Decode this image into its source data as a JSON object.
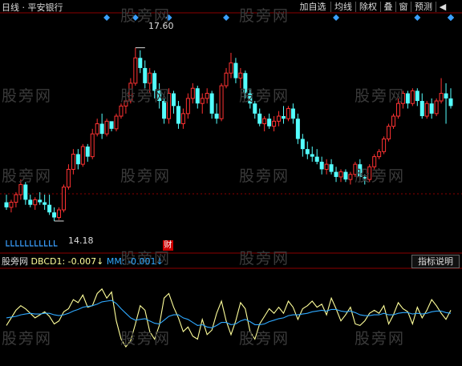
{
  "toolbar": {
    "title": "日线 · 平安银行",
    "buttons": [
      "加自选",
      "均线",
      "除权",
      "叠",
      "窗",
      "预测"
    ],
    "arrow": "◀"
  },
  "watermark": "股旁网",
  "price_panel": {
    "max_label": "17.60",
    "min_label": "14.18",
    "finance_badge": "财"
  },
  "indicator_panel": {
    "prefix": "股旁网",
    "dbcd_label": "DBCD1: -0.007",
    "mm_label": "MM: -0.001",
    "help_button": "指标说明"
  },
  "colors": {
    "up": "#ff3232",
    "down": "#54ffff",
    "dbcd": "#ffff9a",
    "mm": "#2fa9ff",
    "grid": "#8b0000",
    "marker": "#3aa0ff"
  },
  "chart_data": [
    {
      "type": "candlestick",
      "title": "日线 平安银行",
      "ylim": [
        13.8,
        18.1
      ],
      "annotations": [
        {
          "text": "17.60",
          "at": "high"
        },
        {
          "text": "14.18",
          "at": "low"
        }
      ],
      "candles": [
        [
          14.55,
          14.7,
          14.4,
          14.45
        ],
        [
          14.45,
          14.6,
          14.35,
          14.55
        ],
        [
          14.55,
          14.75,
          14.45,
          14.7
        ],
        [
          14.7,
          15.0,
          14.6,
          14.9
        ],
        [
          14.9,
          14.95,
          14.5,
          14.6
        ],
        [
          14.6,
          14.7,
          14.45,
          14.5
        ],
        [
          14.5,
          14.65,
          14.4,
          14.6
        ],
        [
          14.6,
          14.75,
          14.5,
          14.55
        ],
        [
          14.55,
          14.7,
          14.4,
          14.5
        ],
        [
          14.5,
          14.7,
          14.3,
          14.35
        ],
        [
          14.35,
          14.45,
          14.18,
          14.25
        ],
        [
          14.25,
          14.45,
          14.2,
          14.4
        ],
        [
          14.4,
          14.9,
          14.35,
          14.85
        ],
        [
          14.85,
          15.3,
          14.8,
          15.2
        ],
        [
          15.2,
          15.6,
          15.1,
          15.5
        ],
        [
          15.5,
          15.6,
          15.2,
          15.3
        ],
        [
          15.3,
          15.7,
          15.25,
          15.65
        ],
        [
          15.65,
          15.7,
          15.35,
          15.45
        ],
        [
          15.45,
          16.0,
          15.4,
          15.9
        ],
        [
          15.9,
          16.2,
          15.85,
          16.1
        ],
        [
          16.1,
          16.3,
          15.8,
          15.9
        ],
        [
          15.9,
          16.2,
          15.85,
          16.15
        ],
        [
          16.15,
          16.1,
          15.95,
          16.0
        ],
        [
          16.0,
          16.3,
          15.95,
          16.25
        ],
        [
          16.25,
          16.5,
          16.2,
          16.45
        ],
        [
          16.45,
          16.6,
          16.3,
          16.55
        ],
        [
          16.55,
          17.0,
          16.5,
          16.9
        ],
        [
          16.9,
          17.6,
          16.85,
          17.4
        ],
        [
          17.4,
          17.55,
          17.1,
          17.2
        ],
        [
          17.2,
          17.35,
          16.8,
          16.9
        ],
        [
          16.9,
          17.2,
          16.7,
          17.1
        ],
        [
          17.1,
          17.15,
          16.6,
          16.75
        ],
        [
          16.75,
          16.9,
          16.4,
          16.55
        ],
        [
          16.55,
          16.6,
          16.1,
          16.2
        ],
        [
          16.2,
          16.8,
          16.1,
          16.7
        ],
        [
          16.7,
          16.75,
          16.3,
          16.45
        ],
        [
          16.45,
          16.55,
          16.0,
          16.1
        ],
        [
          16.1,
          16.4,
          16.0,
          16.3
        ],
        [
          16.3,
          16.7,
          16.2,
          16.6
        ],
        [
          16.6,
          16.9,
          16.5,
          16.8
        ],
        [
          16.8,
          16.85,
          16.4,
          16.5
        ],
        [
          16.5,
          16.7,
          16.3,
          16.6
        ],
        [
          16.6,
          16.8,
          16.5,
          16.7
        ],
        [
          16.7,
          16.75,
          16.2,
          16.3
        ],
        [
          16.3,
          16.5,
          16.1,
          16.2
        ],
        [
          16.2,
          16.9,
          16.15,
          16.85
        ],
        [
          16.85,
          17.2,
          16.8,
          17.1
        ],
        [
          17.1,
          17.5,
          17.0,
          17.3
        ],
        [
          17.3,
          17.4,
          16.9,
          17.0
        ],
        [
          17.0,
          17.2,
          16.8,
          17.1
        ],
        [
          17.1,
          17.15,
          16.6,
          16.7
        ],
        [
          16.7,
          16.8,
          16.4,
          16.5
        ],
        [
          16.5,
          16.55,
          16.2,
          16.3
        ],
        [
          16.3,
          16.4,
          16.05,
          16.1
        ],
        [
          16.1,
          16.25,
          15.95,
          16.2
        ],
        [
          16.2,
          16.3,
          16.0,
          16.05
        ],
        [
          16.05,
          16.25,
          15.95,
          16.15
        ],
        [
          16.15,
          16.35,
          16.05,
          16.25
        ],
        [
          16.25,
          16.45,
          16.1,
          16.2
        ],
        [
          16.2,
          16.45,
          16.15,
          16.4
        ],
        [
          16.4,
          16.5,
          16.1,
          16.2
        ],
        [
          16.2,
          16.3,
          15.7,
          15.8
        ],
        [
          15.8,
          15.9,
          15.45,
          15.6
        ],
        [
          15.6,
          15.75,
          15.4,
          15.5
        ],
        [
          15.5,
          15.65,
          15.35,
          15.45
        ],
        [
          15.45,
          15.6,
          15.3,
          15.35
        ],
        [
          15.35,
          15.45,
          15.1,
          15.2
        ],
        [
          15.2,
          15.4,
          15.1,
          15.3
        ],
        [
          15.3,
          15.4,
          15.1,
          15.15
        ],
        [
          15.15,
          15.25,
          14.95,
          15.05
        ],
        [
          15.05,
          15.2,
          14.95,
          15.15
        ],
        [
          15.15,
          15.2,
          14.95,
          15.0
        ],
        [
          15.0,
          15.15,
          14.9,
          15.1
        ],
        [
          15.1,
          15.35,
          15.05,
          15.3
        ],
        [
          15.3,
          15.4,
          15.0,
          15.05
        ],
        [
          15.05,
          15.1,
          14.9,
          15.0
        ],
        [
          15.0,
          15.3,
          14.95,
          15.25
        ],
        [
          15.25,
          15.5,
          15.2,
          15.45
        ],
        [
          15.45,
          15.6,
          15.4,
          15.55
        ],
        [
          15.55,
          15.85,
          15.5,
          15.8
        ],
        [
          15.8,
          16.1,
          15.75,
          16.05
        ],
        [
          16.05,
          16.3,
          16.0,
          16.25
        ],
        [
          16.25,
          16.6,
          16.2,
          16.5
        ],
        [
          16.5,
          16.75,
          16.4,
          16.7
        ],
        [
          16.7,
          16.75,
          16.4,
          16.5
        ],
        [
          16.5,
          16.8,
          16.45,
          16.75
        ],
        [
          16.75,
          16.8,
          16.45,
          16.55
        ],
        [
          16.55,
          16.7,
          16.2,
          16.25
        ],
        [
          16.25,
          16.55,
          16.2,
          16.5
        ],
        [
          16.5,
          16.6,
          16.2,
          16.3
        ],
        [
          16.3,
          16.6,
          16.25,
          16.55
        ],
        [
          16.55,
          17.0,
          16.5,
          16.7
        ],
        [
          16.7,
          16.9,
          16.1,
          16.6
        ],
        [
          16.6,
          16.8,
          16.4,
          16.45
        ]
      ],
      "top_markers": [
        21,
        27,
        34,
        46,
        69,
        86,
        95,
        97,
        102,
        106,
        113,
        119
      ]
    },
    {
      "type": "line",
      "title": "DBCD",
      "ylim": [
        -0.06,
        0.06
      ],
      "series": [
        {
          "name": "DBCD1",
          "color": "#ffff9a",
          "values": [
            -0.012,
            -0.002,
            0.008,
            0.014,
            0.01,
            0.004,
            -0.002,
            0.002,
            0.006,
            0.0,
            -0.01,
            -0.006,
            0.006,
            0.01,
            0.022,
            0.018,
            0.028,
            0.012,
            0.014,
            0.03,
            0.036,
            0.024,
            0.032,
            -0.006,
            -0.03,
            -0.04,
            -0.032,
            -0.01,
            0.014,
            0.008,
            -0.02,
            -0.03,
            -0.012,
            0.024,
            0.03,
            0.012,
            -0.002,
            -0.02,
            -0.014,
            -0.026,
            -0.03,
            -0.004,
            -0.024,
            -0.018,
            0.004,
            0.02,
            -0.006,
            -0.024,
            -0.006,
            0.018,
            0.01,
            -0.02,
            -0.03,
            -0.01,
            0.0,
            0.01,
            0.004,
            0.012,
            0.004,
            0.02,
            0.012,
            -0.004,
            0.01,
            0.014,
            0.02,
            0.012,
            0.016,
            0.002,
            0.024,
            0.01,
            -0.006,
            0.002,
            0.012,
            -0.01,
            -0.012,
            -0.006,
            0.004,
            0.008,
            0.004,
            0.014,
            -0.01,
            0.002,
            0.018,
            0.01,
            0.006,
            -0.01,
            0.012,
            -0.002,
            0.008,
            0.022,
            0.014,
            0.004,
            -0.004,
            0.008
          ]
        },
        {
          "name": "MM",
          "color": "#2fa9ff",
          "values": [
            -0.002,
            -0.001,
            0.0,
            0.002,
            0.003,
            0.004,
            0.003,
            0.003,
            0.004,
            0.004,
            0.002,
            0.001,
            0.002,
            0.004,
            0.007,
            0.009,
            0.012,
            0.013,
            0.014,
            0.016,
            0.019,
            0.02,
            0.021,
            0.017,
            0.01,
            0.004,
            -0.002,
            -0.005,
            -0.004,
            -0.003,
            -0.006,
            -0.009,
            -0.01,
            -0.005,
            0.0,
            0.002,
            0.002,
            -0.002,
            -0.004,
            -0.008,
            -0.012,
            -0.011,
            -0.014,
            -0.015,
            -0.012,
            -0.008,
            -0.008,
            -0.011,
            -0.01,
            -0.006,
            -0.004,
            -0.007,
            -0.011,
            -0.011,
            -0.01,
            -0.007,
            -0.005,
            -0.003,
            -0.002,
            0.001,
            0.002,
            0.002,
            0.003,
            0.004,
            0.006,
            0.007,
            0.008,
            0.007,
            0.009,
            0.009,
            0.007,
            0.006,
            0.007,
            0.005,
            0.002,
            0.001,
            0.001,
            0.002,
            0.002,
            0.004,
            0.002,
            0.002,
            0.004,
            0.005,
            0.005,
            0.003,
            0.004,
            0.003,
            0.004,
            0.006,
            0.007,
            0.007,
            0.005,
            0.004
          ]
        }
      ]
    }
  ]
}
